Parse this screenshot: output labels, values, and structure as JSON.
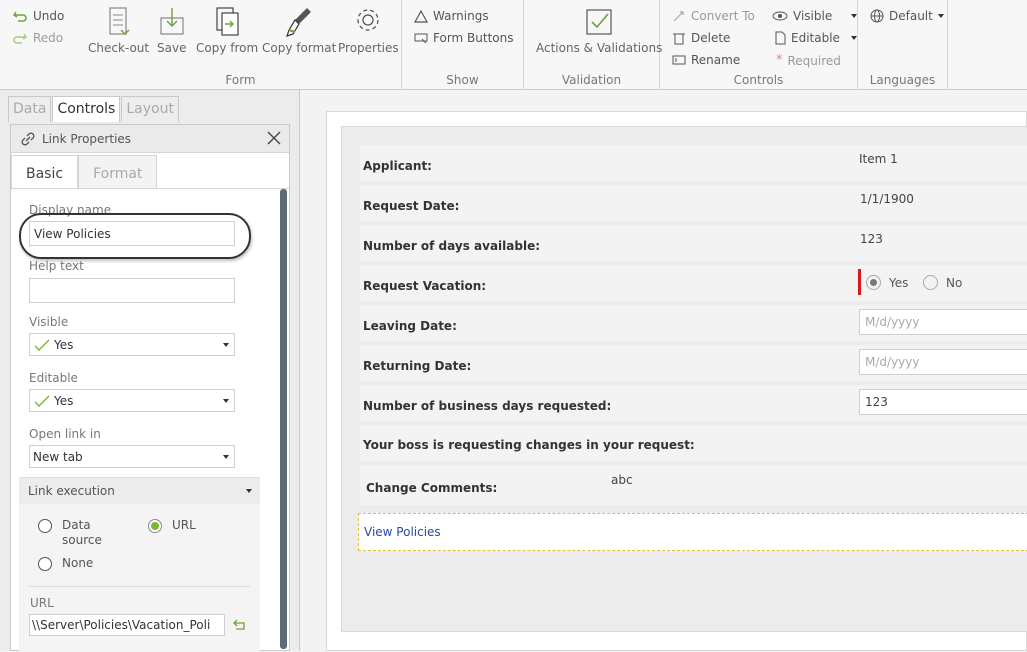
{
  "ribbon": {
    "undo": "Undo",
    "redo": "Redo",
    "form_group": {
      "label": "Form",
      "checkout": "Check-out",
      "save": "Save",
      "copy_from": "Copy from",
      "copy_format": "Copy format",
      "properties": "Properties"
    },
    "show_group": {
      "label": "Show",
      "warnings": "Warnings",
      "form_buttons": "Form Buttons"
    },
    "validation_group": {
      "label": "Validation",
      "actions_validations": "Actions & Validations"
    },
    "controls_group": {
      "label": "Controls",
      "convert_to": "Convert To",
      "delete": "Delete",
      "rename": "Rename",
      "visible": "Visible",
      "editable": "Editable",
      "required": "Required"
    },
    "languages_group": {
      "label": "Languages",
      "default": "Default"
    }
  },
  "left_tabs": [
    "Data",
    "Controls",
    "Layout"
  ],
  "properties_panel": {
    "title": "Link Properties",
    "subtabs": [
      "Basic",
      "Format"
    ],
    "display_name_label": "Display name",
    "display_name_value": "View Policies",
    "help_text_label": "Help text",
    "help_text_value": "",
    "visible_label": "Visible",
    "visible_value": "Yes",
    "editable_label": "Editable",
    "editable_value": "Yes",
    "open_link_label": "Open link in",
    "open_link_value": "New tab",
    "link_execution": {
      "header": "Link execution",
      "data_source": "Data source",
      "url_option": "URL",
      "none": "None",
      "selected": "URL"
    },
    "url_label": "URL",
    "url_value": "\\\\Server\\Policies\\Vacation_Poli"
  },
  "form": {
    "applicant_label": "Applicant:",
    "applicant_value": "Item 1",
    "request_date_label": "Request Date:",
    "request_date_value": "1/1/1900",
    "days_available_label": "Number of days available:",
    "days_available_value": "123",
    "request_vacation_label": "Request Vacation:",
    "vacation_yes": "Yes",
    "vacation_no": "No",
    "leaving_date_label": "Leaving Date:",
    "leaving_date_placeholder": "M/d/yyyy",
    "returning_date_label": "Returning Date:",
    "returning_date_placeholder": "M/d/yyyy",
    "business_days_label": "Number of business days requested:",
    "business_days_value": "123",
    "boss_changes_label": "Your boss is requesting changes in your request:",
    "change_comments_label": "Change Comments:",
    "change_comments_value": "abc",
    "link_text": "View Policies"
  },
  "colors": {
    "accent_green": "#7ab733",
    "required_red": "#d71920",
    "link_blue": "#2b4aa0"
  }
}
